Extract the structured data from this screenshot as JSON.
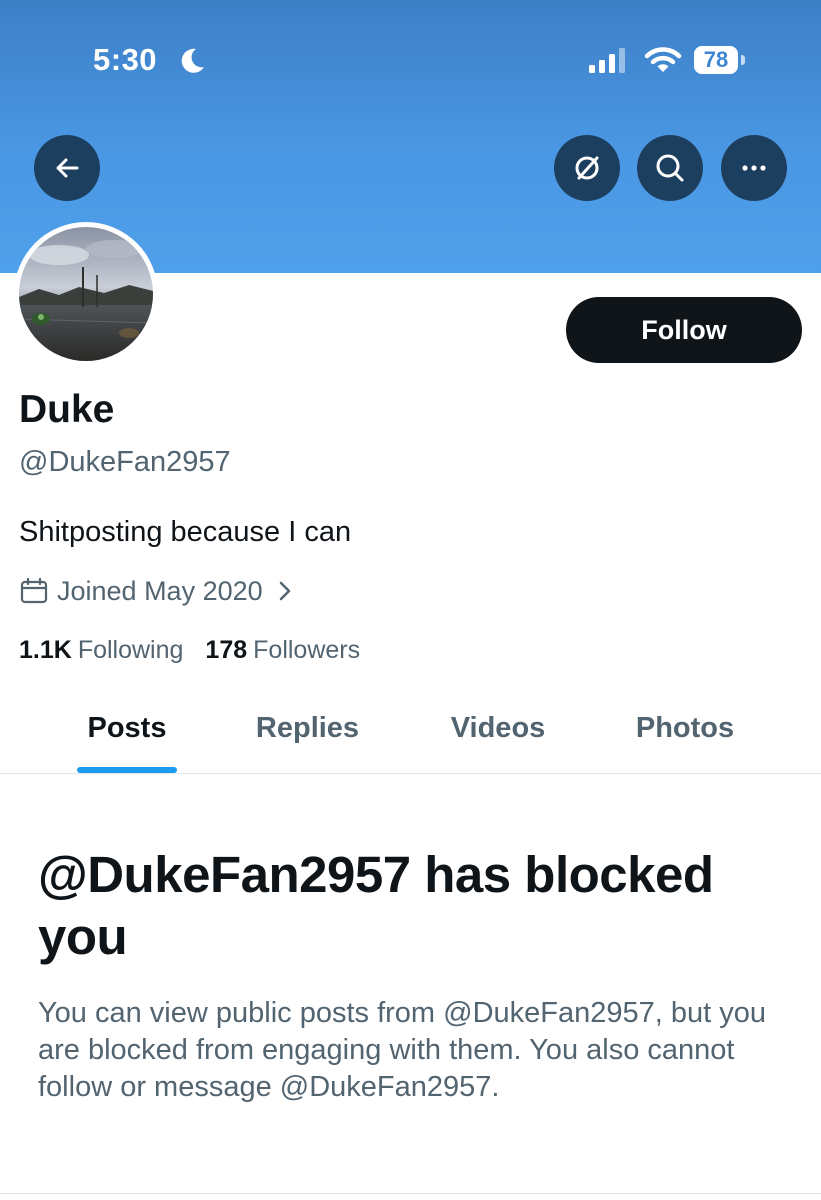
{
  "status_bar": {
    "time": "5:30",
    "battery_level": "78",
    "moon_icon": "moon-icon",
    "signal_icon": "cellular-signal-icon",
    "wifi_icon": "wifi-icon"
  },
  "header": {
    "back_icon": "arrow-left-icon",
    "grok_icon": "grok-icon",
    "search_icon": "search-icon",
    "more_icon": "more-horizontal-icon"
  },
  "profile": {
    "display_name": "Duke",
    "handle": "@DukeFan2957",
    "bio": "Shitposting because I can",
    "joined": "Joined May 2020",
    "following_count": "1.1K",
    "following_label": "Following",
    "followers_count": "178",
    "followers_label": "Followers",
    "follow_button": "Follow"
  },
  "tabs": [
    {
      "label": "Posts",
      "active": true
    },
    {
      "label": "Replies",
      "active": false
    },
    {
      "label": "Videos",
      "active": false
    },
    {
      "label": "Photos",
      "active": false
    }
  ],
  "blocked_notice": {
    "title": "@DukeFan2957 has blocked you",
    "description": "You can view public posts from @DukeFan2957, but you are blocked from engaging with them. You also cannot follow or message @DukeFan2957."
  },
  "colors": {
    "banner": "#4a97e3",
    "header_button": "#1d3f5f",
    "accent": "#1d9bf0",
    "primary_text": "#0f1419",
    "secondary_text": "#536471"
  }
}
